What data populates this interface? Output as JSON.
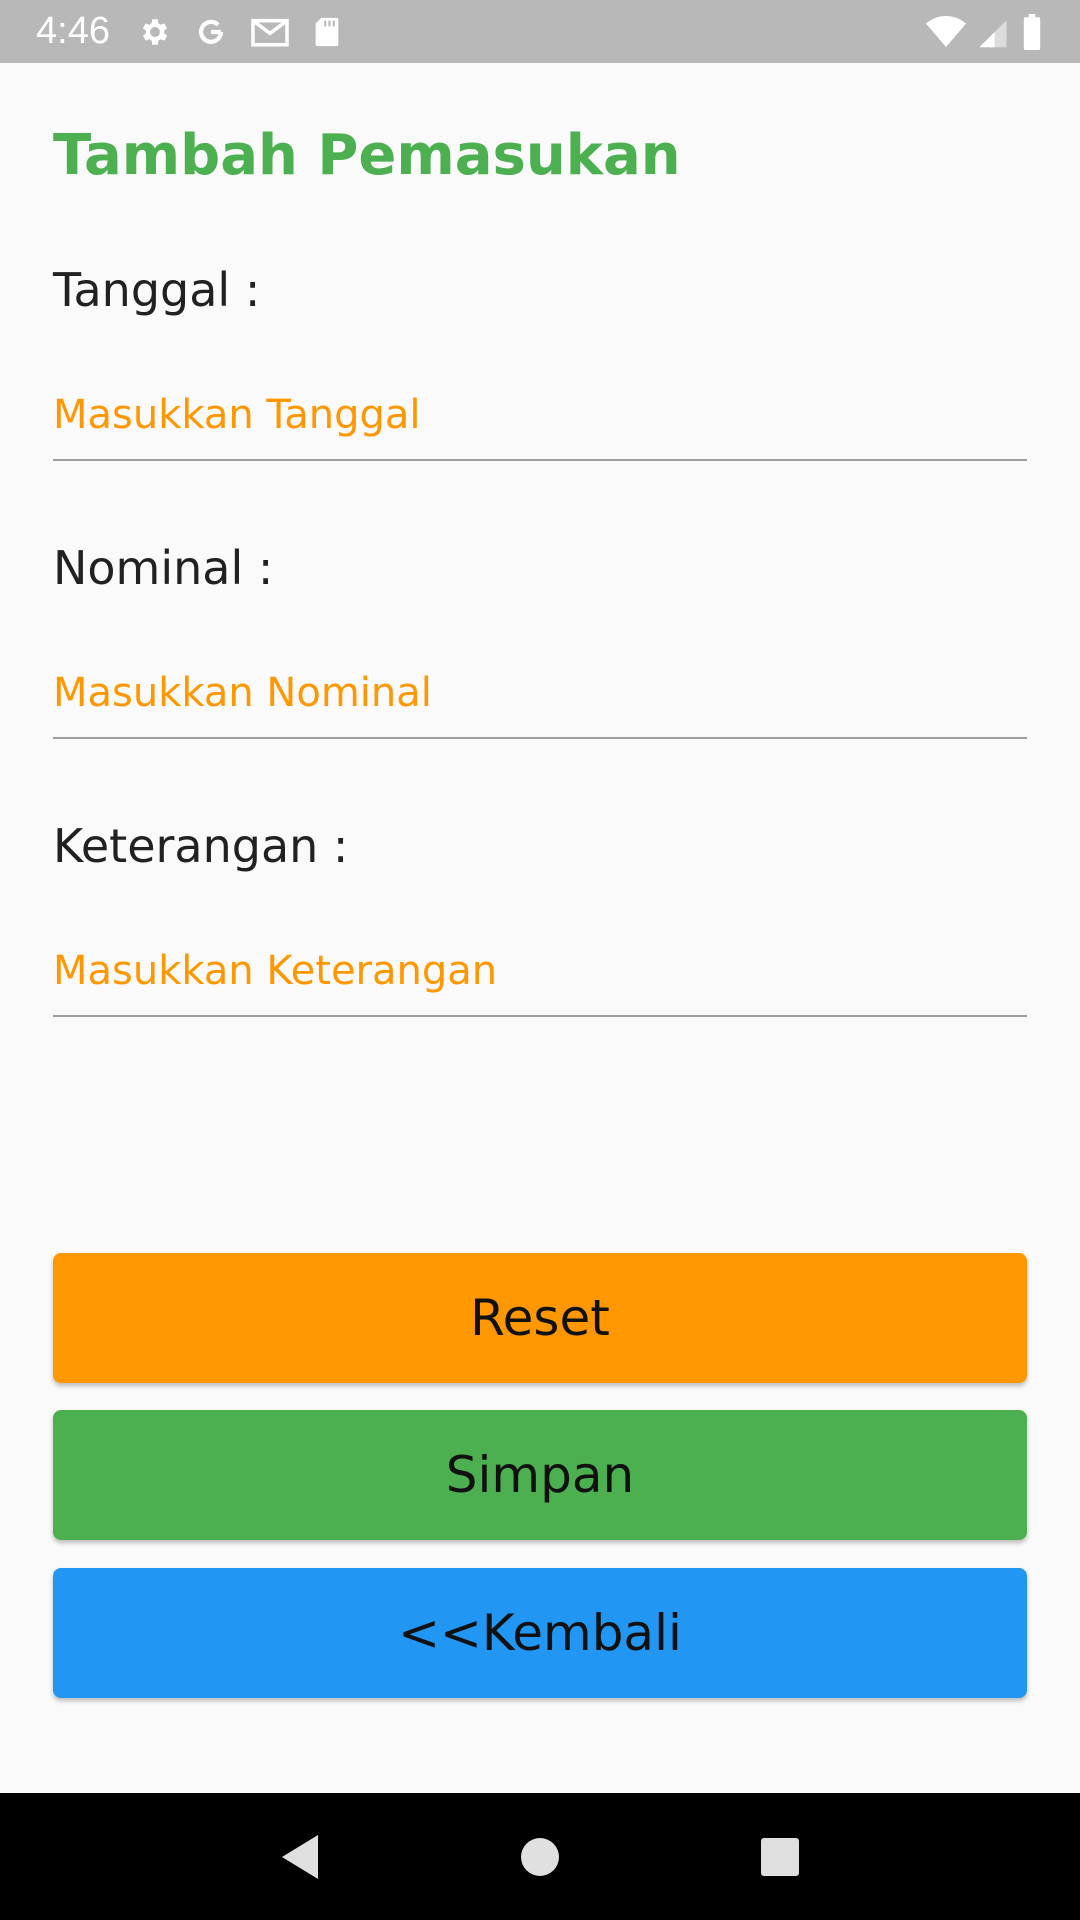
{
  "status_bar": {
    "time": "4:46",
    "left_icons": [
      "gear-icon",
      "google-icon",
      "gmail-icon",
      "sd-card-icon"
    ],
    "right_icons": [
      "wifi-icon",
      "signal-icon",
      "battery-icon"
    ]
  },
  "page": {
    "title": "Tambah Pemasukan"
  },
  "form": {
    "tanggal": {
      "label": "Tanggal :",
      "placeholder": "Masukkan Tanggal",
      "value": ""
    },
    "nominal": {
      "label": "Nominal :",
      "placeholder": "Masukkan Nominal",
      "value": ""
    },
    "keterangan": {
      "label": "Keterangan :",
      "placeholder": "Masukkan Keterangan",
      "value": ""
    }
  },
  "buttons": {
    "reset": "Reset",
    "save": "Simpan",
    "back": "<<Kembali"
  },
  "colors": {
    "title": "#4caf50",
    "placeholder": "#ff9800",
    "reset": "#ff9800",
    "save": "#4caf50",
    "back": "#2196f3"
  },
  "nav_bar": {
    "icons": [
      "back-triangle-icon",
      "home-circle-icon",
      "recents-square-icon"
    ]
  }
}
